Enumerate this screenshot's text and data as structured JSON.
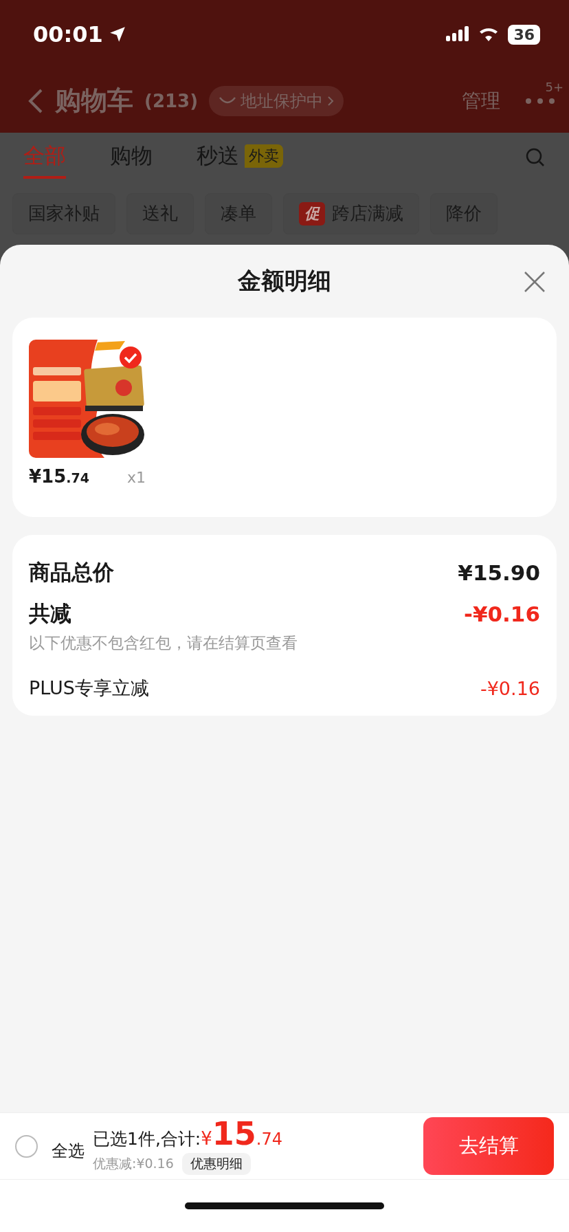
{
  "status_bar": {
    "time": "00:01",
    "battery": "36"
  },
  "nav": {
    "title": "购物车",
    "count": "(213)",
    "address_pill": "地址保护中",
    "manage": "管理",
    "more_badge": "5+"
  },
  "tabs": [
    {
      "label": "全部",
      "selected": true
    },
    {
      "label": "购物",
      "selected": false
    },
    {
      "label": "秒送",
      "selected": false,
      "badge": "外卖"
    }
  ],
  "chips": [
    {
      "label": "国家补贴"
    },
    {
      "label": "送礼"
    },
    {
      "label": "凑单"
    },
    {
      "label": "跨店满减",
      "badge": "促"
    },
    {
      "label": "降价"
    }
  ],
  "sheet": {
    "title": "金额明细",
    "items": [
      {
        "kind": "picture",
        "checked": true,
        "price_currency": "¥",
        "price_integer": "15",
        "price_decimal": ".74",
        "quantity": "x1"
      }
    ],
    "summary": [
      {
        "kind": "main",
        "label": "商品总价",
        "value": "¥15.90",
        "negative": false
      },
      {
        "kind": "main",
        "label": "共减",
        "value": "-¥0.16",
        "negative": true,
        "note": "以下优惠不包含红包，请在结算页查看"
      },
      {
        "kind": "sub",
        "label": "PLUS专享立减",
        "value": "-¥0.16",
        "negative": true
      }
    ]
  },
  "bottom_bar": {
    "select_all": {
      "label": "全选",
      "checked": false
    },
    "selected_label": "已选1件,合计:",
    "total_currency": "¥",
    "total_integer": "15",
    "total_decimal": ".74",
    "discount": "优惠减:¥0.16",
    "details_button": "优惠明细",
    "checkout_button": "去结算"
  }
}
